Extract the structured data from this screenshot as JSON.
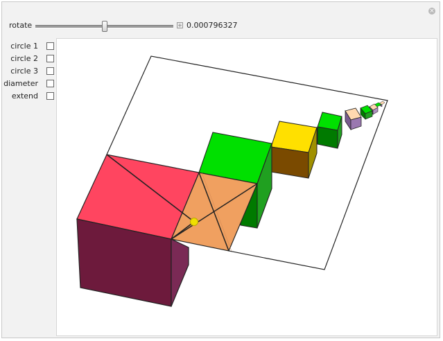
{
  "controls": {
    "rotate_label": "rotate",
    "rotate_value": "0.000796327",
    "slider_position": 0.5,
    "plus_label": "+",
    "close_label": "×"
  },
  "checkboxes": [
    {
      "label": "circle 1",
      "checked": false
    },
    {
      "label": "circle 2",
      "checked": false
    },
    {
      "label": "circle 3",
      "checked": false
    },
    {
      "label": "diameter",
      "checked": false
    },
    {
      "label": "extend",
      "checked": false
    }
  ],
  "scene": {
    "colors": {
      "red_top": "#ff4560",
      "red_side": "#6d1a3c",
      "red_side_right": "#7a2a55",
      "orange_top": "#f0a060",
      "green_top": "#00e000",
      "green_side": "#007a00",
      "green_side_dark": "#20a020",
      "yellow_top": "#ffe000",
      "brown_side": "#7a4a00",
      "olive_side": "#a09000",
      "peach_top": "#ffd8b0",
      "purple_side": "#7a5a90",
      "center_point": "#f0e000"
    }
  }
}
